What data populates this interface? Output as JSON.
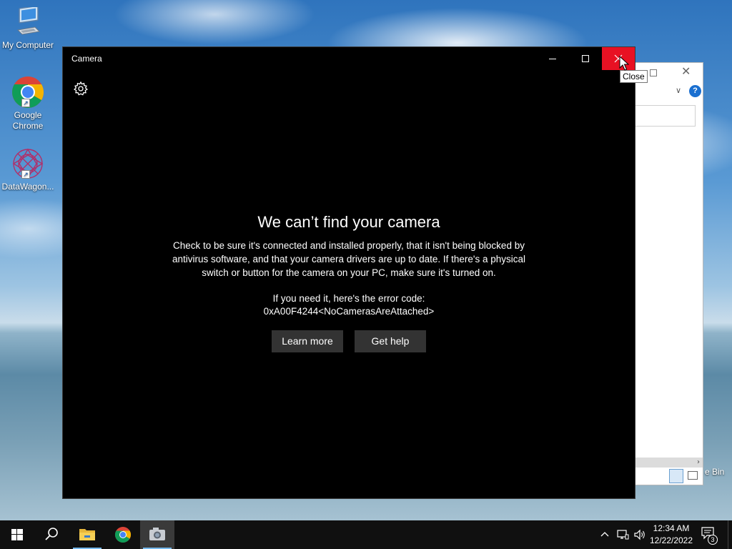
{
  "desktop": {
    "icons": [
      {
        "label": "My Computer",
        "icon": "computer-icon"
      },
      {
        "label": "Google Chrome",
        "icon": "chrome-icon"
      },
      {
        "label": "DataWagon...",
        "icon": "datawagon-icon"
      }
    ],
    "recycle_bin_partial_label": "e Bin"
  },
  "background_window": {
    "help_label": "?"
  },
  "camera_window": {
    "title": "Camera",
    "error_title": "We can’t find your camera",
    "error_body": "Check to be sure it's connected and installed properly, that it isn't being blocked by antivirus software, and that your camera drivers are up to date. If there's a physical switch or button for the camera on your PC, make sure it's turned on.",
    "error_code_label": "If you need it, here's the error code:",
    "error_code": "0xA00F4244<NoCamerasAreAttached>",
    "learn_more_label": "Learn more",
    "get_help_label": "Get help",
    "close_tooltip": "Close",
    "close_button_color": "#e81123"
  },
  "taskbar": {
    "time": "12:34 AM",
    "date": "12/22/2022",
    "notification_count": "3",
    "pinned": [
      "start-icon",
      "search-icon",
      "file-explorer-icon",
      "chrome-icon",
      "camera-icon"
    ],
    "accent": "#76b9ed"
  }
}
